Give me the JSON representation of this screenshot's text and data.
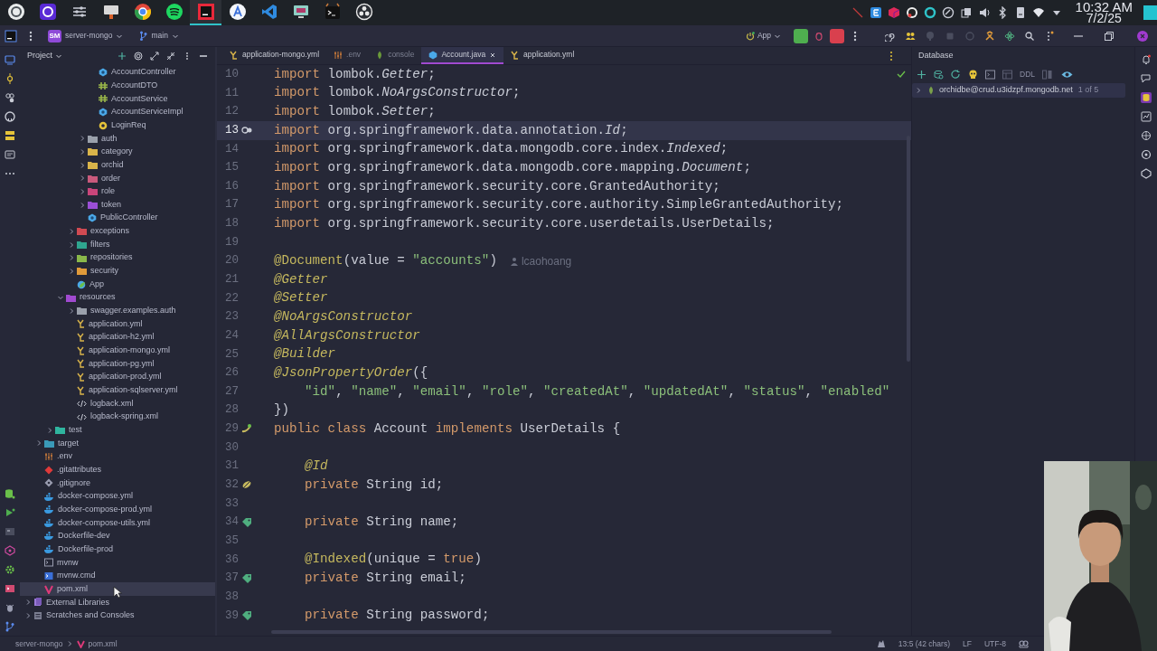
{
  "taskbar": {
    "apps": [
      {
        "kind": "launcher",
        "active": false
      },
      {
        "kind": "ring",
        "active": false
      },
      {
        "kind": "sliders",
        "active": false
      },
      {
        "kind": "monitor",
        "active": false
      },
      {
        "kind": "browser",
        "active": false
      },
      {
        "kind": "music",
        "active": false
      },
      {
        "kind": "ide",
        "active": true
      },
      {
        "kind": "store",
        "active": false
      },
      {
        "kind": "editor",
        "active": false
      },
      {
        "kind": "display",
        "active": false
      },
      {
        "kind": "terminal",
        "active": false
      },
      {
        "kind": "recorder",
        "active": false
      }
    ],
    "time": "10:32 AM",
    "date": "7/2/25"
  },
  "header": {
    "project_badge": "SM",
    "project": "server-mongo",
    "branch": "main",
    "run_config": "App"
  },
  "project_panel": {
    "title": "Project",
    "tree": [
      {
        "children": [
          {
            "children": [
              {
                "children": [
                  {
                    "children": [
                      {
                        "children": [
                          {
                            "children": [
                              {
                                "label": "AccountController",
                                "kind": "class",
                                "selected": false
                              },
                              {
                                "label": "AccountDTO",
                                "kind": "interface",
                                "selected": false
                              },
                              {
                                "label": "AccountService",
                                "kind": "interface",
                                "selected": false
                              },
                              {
                                "label": "AccountServiceImpl",
                                "kind": "class",
                                "selected": false
                              },
                              {
                                "label": "LoginReq",
                                "kind": "record",
                                "selected": false
                              }
                            ]
                          },
                          {
                            "label": "auth",
                            "kind": "folder",
                            "color": "#9aa0ab",
                            "expanded": false,
                            "selected": false
                          },
                          {
                            "label": "category",
                            "kind": "folder",
                            "color": "#d9b44a",
                            "expanded": false,
                            "selected": false
                          },
                          {
                            "label": "orchid",
                            "kind": "folder",
                            "color": "#d9b44a",
                            "expanded": false,
                            "selected": false
                          },
                          {
                            "label": "order",
                            "kind": "folder",
                            "color": "#c95a7c",
                            "expanded": false,
                            "selected": false
                          },
                          {
                            "label": "role",
                            "kind": "folder",
                            "color": "#c9457a",
                            "expanded": false,
                            "selected": false
                          },
                          {
                            "label": "token",
                            "kind": "folder",
                            "color": "#9b4fd6",
                            "expanded": false,
                            "selected": false
                          },
                          {
                            "label": "PublicController",
                            "kind": "class",
                            "selected": false
                          }
                        ]
                      },
                      {
                        "label": "exceptions",
                        "kind": "folder",
                        "color": "#d04a52",
                        "expanded": false,
                        "selected": false
                      },
                      {
                        "label": "filters",
                        "kind": "folder",
                        "color": "#2fa58f",
                        "expanded": false,
                        "selected": false
                      },
                      {
                        "label": "repositories",
                        "kind": "folder",
                        "color": "#8ab84a",
                        "expanded": false,
                        "selected": false
                      },
                      {
                        "label": "security",
                        "kind": "folder",
                        "color": "#e09a3a",
                        "expanded": false,
                        "selected": false
                      },
                      {
                        "label": "App",
                        "kind": "app",
                        "selected": false
                      }
                    ]
                  },
                  {
                    "label": "resources",
                    "kind": "folder",
                    "color": "#a04ad0",
                    "expanded": true,
                    "selected": false,
                    "children": [
                      {
                        "label": "swagger.examples.auth",
                        "kind": "folder",
                        "color": "#9aa0ab",
                        "expanded": false,
                        "selected": false
                      },
                      {
                        "label": "application.yml",
                        "kind": "yaml",
                        "selected": false
                      },
                      {
                        "label": "application-h2.yml",
                        "kind": "yaml",
                        "selected": false
                      },
                      {
                        "label": "application-mongo.yml",
                        "kind": "yaml",
                        "selected": false
                      },
                      {
                        "label": "application-pg.yml",
                        "kind": "yaml",
                        "selected": false
                      },
                      {
                        "label": "application-prod.yml",
                        "kind": "yaml",
                        "selected": false
                      },
                      {
                        "label": "application-sqlserver.yml",
                        "kind": "yaml",
                        "selected": false
                      },
                      {
                        "label": "logback.xml",
                        "kind": "xml",
                        "selected": false
                      },
                      {
                        "label": "logback-spring.xml",
                        "kind": "xml",
                        "selected": false
                      }
                    ]
                  }
                ]
              },
              {
                "label": "test",
                "kind": "folder",
                "color": "#2fb59f",
                "expanded": false,
                "selected": false
              }
            ]
          },
          {
            "label": "target",
            "kind": "folder",
            "color": "#3a9ab8",
            "expanded": false,
            "selected": false
          },
          {
            "label": ".env",
            "kind": "env",
            "selected": false
          },
          {
            "label": ".gitattributes",
            "kind": "git",
            "selected": false
          },
          {
            "label": ".gitignore",
            "kind": "gitignore",
            "selected": false
          },
          {
            "label": "docker-compose.yml",
            "kind": "docker",
            "selected": false
          },
          {
            "label": "docker-compose-prod.yml",
            "kind": "docker",
            "selected": false
          },
          {
            "label": "docker-compose-utils.yml",
            "kind": "docker",
            "selected": false
          },
          {
            "label": "Dockerfile-dev",
            "kind": "docker",
            "selected": false
          },
          {
            "label": "Dockerfile-prod",
            "kind": "docker",
            "selected": false
          },
          {
            "label": "mvnw",
            "kind": "shell",
            "selected": false
          },
          {
            "label": "mvnw.cmd",
            "kind": "cmd",
            "selected": false
          },
          {
            "label": "pom.xml",
            "kind": "maven",
            "selected": true
          }
        ]
      },
      {
        "label": "External Libraries",
        "kind": "library",
        "expanded": false,
        "selected": false
      },
      {
        "label": "Scratches and Consoles",
        "kind": "scratch",
        "expanded": false,
        "selected": false
      }
    ]
  },
  "editor": {
    "tabs": [
      {
        "label": "application-mongo.yml",
        "kind": "yaml",
        "muted": false,
        "selected": false
      },
      {
        "label": ".env",
        "kind": "env",
        "muted": true,
        "selected": false
      },
      {
        "label": "console",
        "kind": "mongo",
        "muted": true,
        "selected": false
      },
      {
        "label": "Account.java",
        "kind": "class",
        "muted": false,
        "selected": true
      },
      {
        "label": "application.yml",
        "kind": "yaml",
        "muted": false,
        "selected": false
      }
    ],
    "lines": [
      {
        "number": "10",
        "current": false,
        "segments": [
          {
            "kind": "kw",
            "text": "import"
          },
          {
            "kind": "plain",
            "text": " lombok."
          },
          {
            "kind": "type",
            "text": "Getter"
          },
          {
            "kind": "plain",
            "text": ";"
          }
        ]
      },
      {
        "number": "11",
        "current": false,
        "segments": [
          {
            "kind": "kw",
            "text": "import"
          },
          {
            "kind": "plain",
            "text": " lombok."
          },
          {
            "kind": "type",
            "text": "NoArgsConstructor"
          },
          {
            "kind": "plain",
            "text": ";"
          }
        ]
      },
      {
        "number": "12",
        "current": false,
        "segments": [
          {
            "kind": "kw",
            "text": "import"
          },
          {
            "kind": "plain",
            "text": " lombok."
          },
          {
            "kind": "type",
            "text": "Setter"
          },
          {
            "kind": "plain",
            "text": ";"
          }
        ]
      },
      {
        "number": "13",
        "current": true,
        "gutter": {
          "kind": "gear"
        },
        "segments": [
          {
            "kind": "kw",
            "text": "import"
          },
          {
            "kind": "plain",
            "text": " org.springframework.data.annotation."
          },
          {
            "kind": "type",
            "text": "Id"
          },
          {
            "kind": "plain",
            "text": ";"
          }
        ]
      },
      {
        "number": "14",
        "current": false,
        "segments": [
          {
            "kind": "kw",
            "text": "import"
          },
          {
            "kind": "plain",
            "text": " org.springframework.data.mongodb.core.index."
          },
          {
            "kind": "type",
            "text": "Indexed"
          },
          {
            "kind": "plain",
            "text": ";"
          }
        ]
      },
      {
        "number": "15",
        "current": false,
        "segments": [
          {
            "kind": "kw",
            "text": "import"
          },
          {
            "kind": "plain",
            "text": " org.springframework.data.mongodb.core.mapping."
          },
          {
            "kind": "type",
            "text": "Document"
          },
          {
            "kind": "plain",
            "text": ";"
          }
        ]
      },
      {
        "number": "16",
        "current": false,
        "segments": [
          {
            "kind": "kw",
            "text": "import"
          },
          {
            "kind": "plain",
            "text": " org.springframework.security.core.GrantedAuthority;"
          }
        ]
      },
      {
        "number": "17",
        "current": false,
        "segments": [
          {
            "kind": "kw",
            "text": "import"
          },
          {
            "kind": "plain",
            "text": " org.springframework.security.core.authority.SimpleGrantedAuthority;"
          }
        ]
      },
      {
        "number": "18",
        "current": false,
        "segments": [
          {
            "kind": "kw",
            "text": "import"
          },
          {
            "kind": "plain",
            "text": " org.springframework.security.core.userdetails.UserDetails;"
          }
        ]
      },
      {
        "number": "19",
        "current": false
      },
      {
        "number": "20",
        "current": false,
        "segments": [
          {
            "kind": "ann",
            "text": "@Document"
          },
          {
            "kind": "plain",
            "text": "(value = "
          },
          {
            "kind": "str",
            "text": "\"accounts\""
          },
          {
            "kind": "plain",
            "text": ")"
          },
          {
            "kind": "hint",
            "text": "lcaohoang"
          }
        ]
      },
      {
        "number": "21",
        "current": false,
        "segments": [
          {
            "kind": "anni",
            "text": "@Getter"
          }
        ]
      },
      {
        "number": "22",
        "current": false,
        "segments": [
          {
            "kind": "anni",
            "text": "@Setter"
          }
        ]
      },
      {
        "number": "23",
        "current": false,
        "segments": [
          {
            "kind": "anni",
            "text": "@NoArgsConstructor"
          }
        ]
      },
      {
        "number": "24",
        "current": false,
        "segments": [
          {
            "kind": "anni",
            "text": "@AllArgsConstructor"
          }
        ]
      },
      {
        "number": "25",
        "current": false,
        "segments": [
          {
            "kind": "anni",
            "text": "@Builder"
          }
        ]
      },
      {
        "number": "26",
        "current": false,
        "segments": [
          {
            "kind": "anni",
            "text": "@JsonPropertyOrder"
          },
          {
            "kind": "plain",
            "text": "({"
          }
        ]
      },
      {
        "number": "27",
        "current": false,
        "segments": [
          {
            "kind": "str",
            "text": "    \"id\""
          },
          {
            "kind": "plain",
            "text": ", "
          },
          {
            "kind": "str",
            "text": "\"name\""
          },
          {
            "kind": "plain",
            "text": ", "
          },
          {
            "kind": "str",
            "text": "\"email\""
          },
          {
            "kind": "plain",
            "text": ", "
          },
          {
            "kind": "str",
            "text": "\"role\""
          },
          {
            "kind": "plain",
            "text": ", "
          },
          {
            "kind": "str",
            "text": "\"createdAt\""
          },
          {
            "kind": "plain",
            "text": ", "
          },
          {
            "kind": "str",
            "text": "\"updatedAt\""
          },
          {
            "kind": "plain",
            "text": ", "
          },
          {
            "kind": "str",
            "text": "\"status\""
          },
          {
            "kind": "plain",
            "text": ", "
          },
          {
            "kind": "str",
            "text": "\"enabled\""
          }
        ]
      },
      {
        "number": "28",
        "current": false,
        "segments": [
          {
            "kind": "plain",
            "text": "})"
          }
        ]
      },
      {
        "number": "29",
        "current": false,
        "gutter": {
          "kind": "bean"
        },
        "segments": [
          {
            "kind": "kw",
            "text": "public class "
          },
          {
            "kind": "plain",
            "text": "Account "
          },
          {
            "kind": "kw",
            "text": "implements "
          },
          {
            "kind": "plain",
            "text": "UserDetails {"
          }
        ]
      },
      {
        "number": "30",
        "current": false
      },
      {
        "number": "31",
        "current": false,
        "segments": [
          {
            "kind": "anni",
            "text": "    @Id"
          }
        ]
      },
      {
        "number": "32",
        "current": false,
        "gutter": {
          "kind": "leaf"
        },
        "segments": [
          {
            "kind": "kw",
            "text": "    private "
          },
          {
            "kind": "plain",
            "text": "String id;"
          }
        ]
      },
      {
        "number": "33",
        "current": false
      },
      {
        "number": "34",
        "current": false,
        "gutter": {
          "kind": "tag"
        },
        "segments": [
          {
            "kind": "kw",
            "text": "    private "
          },
          {
            "kind": "plain",
            "text": "String name;"
          }
        ]
      },
      {
        "number": "35",
        "current": false
      },
      {
        "number": "36",
        "current": false,
        "segments": [
          {
            "kind": "ann",
            "text": "    @Indexed"
          },
          {
            "kind": "plain",
            "text": "(unique = "
          },
          {
            "kind": "kw",
            "text": "true"
          },
          {
            "kind": "plain",
            "text": ")"
          }
        ]
      },
      {
        "number": "37",
        "current": false,
        "gutter": {
          "kind": "tag"
        },
        "segments": [
          {
            "kind": "kw",
            "text": "    private "
          },
          {
            "kind": "plain",
            "text": "String email;"
          }
        ]
      },
      {
        "number": "38",
        "current": false
      },
      {
        "number": "39",
        "current": false,
        "gutter": {
          "kind": "tag"
        },
        "segments": [
          {
            "kind": "kw",
            "text": "    private "
          },
          {
            "kind": "plain",
            "text": "String password;"
          }
        ]
      }
    ]
  },
  "database": {
    "title": "Database",
    "toolbar_label": "DDL",
    "connections": [
      {
        "label": "orchidbe@crud.u3idzpf.mongodb.net",
        "count": "1 of 5",
        "expanded": false,
        "selected": true
      }
    ]
  },
  "status_bar": {
    "breadcrumbs": [
      "server-mongo",
      "pom.xml"
    ],
    "position": "13:5 (42 chars)",
    "line_separator": "LF",
    "encoding": "UTF-8"
  }
}
